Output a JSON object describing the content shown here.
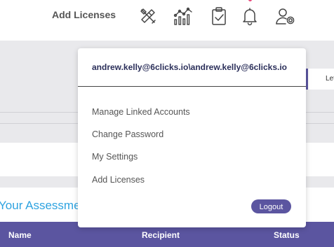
{
  "header": {
    "add_licenses_label": "Add Licenses",
    "icons": [
      "tools-icon",
      "analytics-chart-icon",
      "clipboard-check-icon",
      "bell-icon",
      "user-settings-icon"
    ],
    "notification_dot_color": "#e8477a"
  },
  "background": {
    "right_box_label": "Let",
    "your_assessments_title": "Your Assessments"
  },
  "table": {
    "columns": [
      "Name",
      "Recipient",
      "Status"
    ]
  },
  "dropdown": {
    "account": "andrew.kelly@6clicks.io\\andrew.kelly@6clicks.io",
    "items": [
      "Manage Linked Accounts",
      "Change Password",
      "My Settings",
      "Add Licenses"
    ],
    "logout_label": "Logout"
  },
  "colors": {
    "accent": "#5b55a0",
    "title_blue": "#2ea3e0",
    "page_grey": "#e9e9ec"
  }
}
